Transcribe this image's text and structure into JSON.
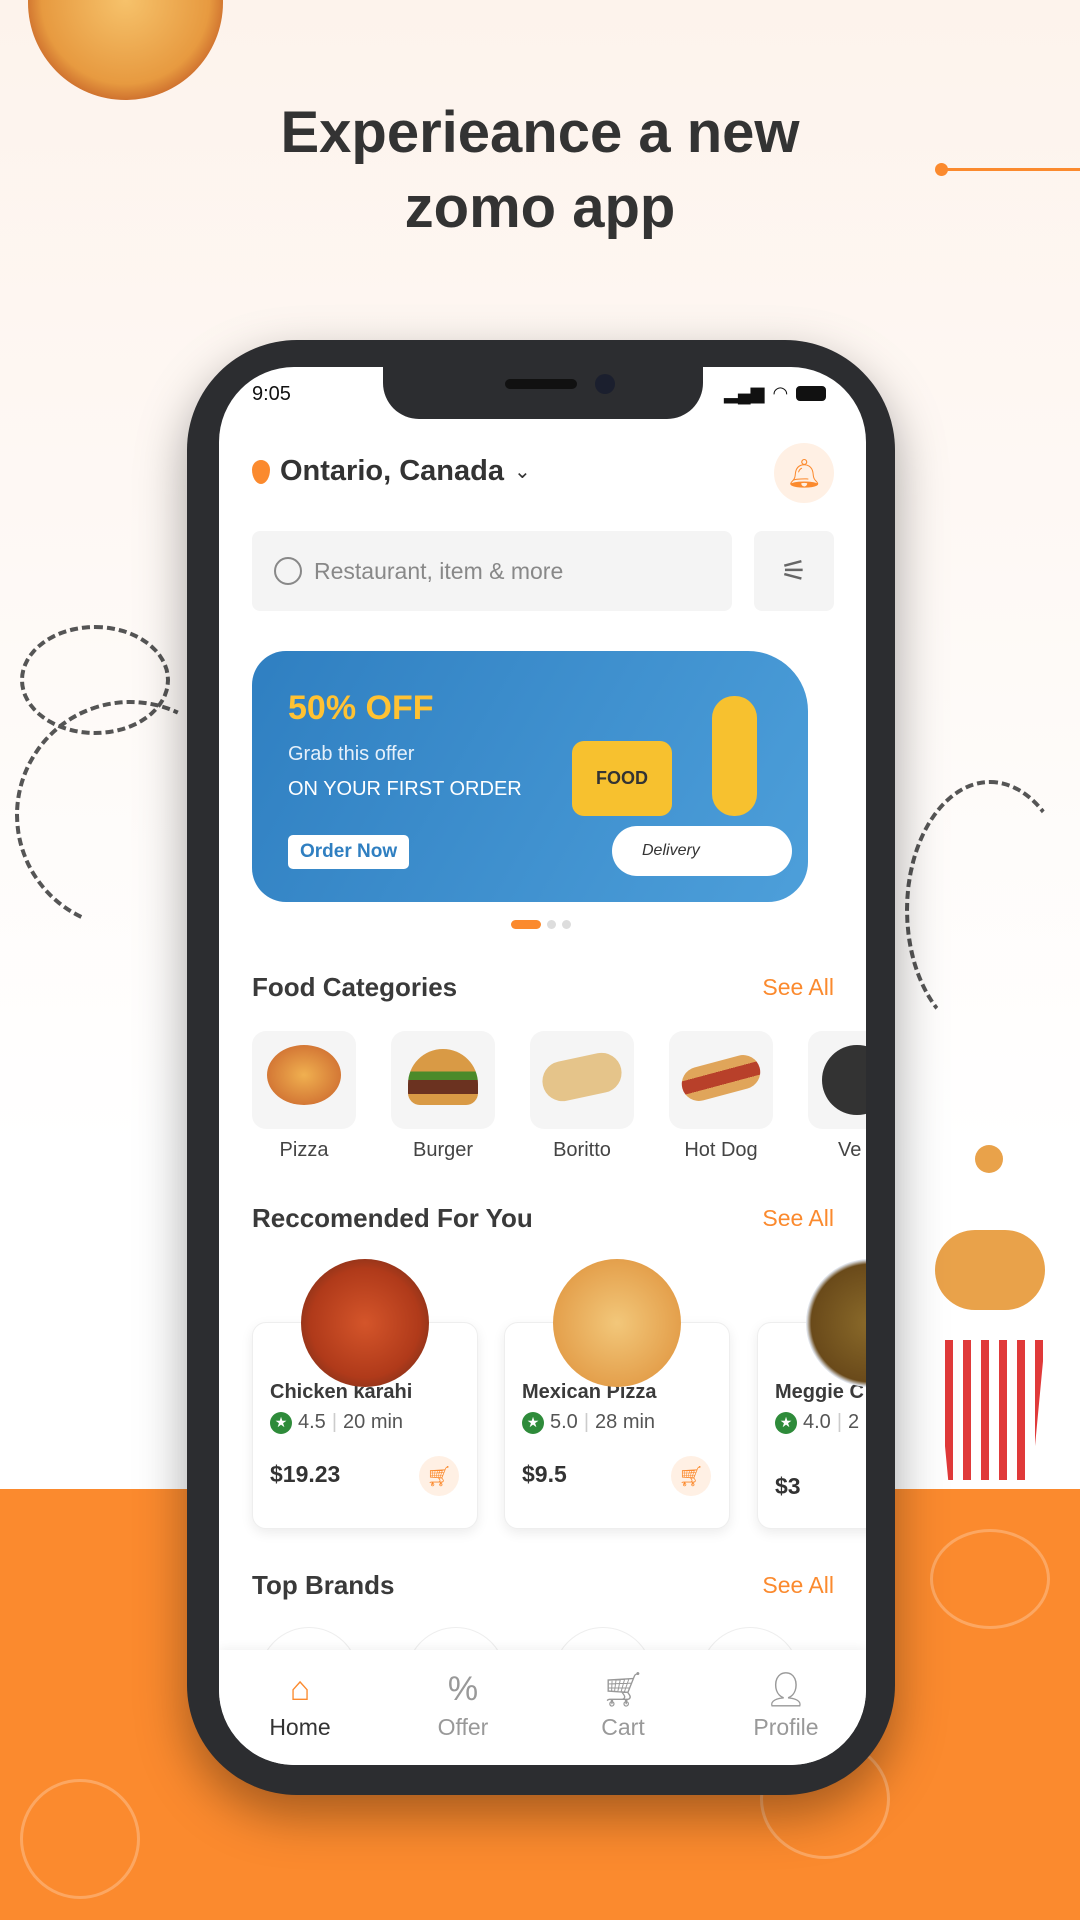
{
  "headline": {
    "line1": "Experieance a new",
    "line2": "zomo app"
  },
  "colors": {
    "accent": "#fb8a2e",
    "banner": "#3b8ccc",
    "rating": "#2e8b3a"
  },
  "status_bar": {
    "time": "9:05"
  },
  "header": {
    "location": "Ontario, Canada",
    "icons": [
      "location-pin-icon",
      "chevron-down-icon",
      "bell-icon"
    ]
  },
  "search": {
    "placeholder": "Restaurant, item & more"
  },
  "banner": {
    "headline": "50% OFF",
    "line1": "Grab this offer",
    "line2": "ON YOUR FIRST ORDER",
    "cta": "Order Now",
    "box_text": "FOOD",
    "scooter_text": "Delivery",
    "active_slide": 1,
    "slides": 3
  },
  "categories": {
    "title": "Food Categories",
    "see_all": "See All",
    "items": [
      {
        "label": "Pizza"
      },
      {
        "label": "Burger"
      },
      {
        "label": "Boritto"
      },
      {
        "label": "Hot Dog"
      },
      {
        "label": "Ve"
      }
    ]
  },
  "recommended": {
    "title": "Reccomended For You",
    "see_all": "See All",
    "items": [
      {
        "name": "Chicken karahi",
        "rating": "4.5",
        "time": "20 min",
        "price": "$19.23"
      },
      {
        "name": "Mexican Pizza",
        "rating": "5.0",
        "time": "28 min",
        "price": "$9.5"
      },
      {
        "name": "Meggie C",
        "rating": "4.0",
        "time": "2",
        "price": "$3"
      }
    ]
  },
  "brands": {
    "title": "Top Brands",
    "see_all": "See All"
  },
  "nav": {
    "items": [
      {
        "label": "Home",
        "active": true
      },
      {
        "label": "Offer"
      },
      {
        "label": "Cart"
      },
      {
        "label": "Profile"
      }
    ]
  }
}
